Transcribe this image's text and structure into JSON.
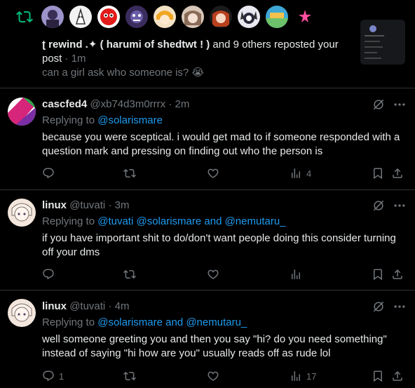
{
  "repost_banner": {
    "avatars": [
      "avatar-1",
      "avatar-2",
      "avatar-3",
      "avatar-4",
      "avatar-5",
      "avatar-6",
      "avatar-7",
      "avatar-8",
      "avatar-9",
      "avatar-10"
    ],
    "display_name": "ʈ rewind .✦ ( harumi of shedtwt ! )",
    "suffix": " and 9 others reposted your",
    "line2_word": "post",
    "sep": " · ",
    "time": "1m",
    "snippet": "can a girl ask who someone is? 😭"
  },
  "tweets": [
    {
      "name": "cascfed4",
      "handle": "@xb74d3m0rrrx",
      "sep": " · ",
      "time": "2m",
      "replying_prefix": "Replying to ",
      "replying_to": "@solarismare",
      "text": "because you were sceptical. i would get mad to if someone responded with a question mark and pressing on finding out who the person is",
      "reply_count": "",
      "repost_count": "",
      "like_count": "",
      "view_count": "4"
    },
    {
      "name": "linux",
      "handle": "@tuvati",
      "sep": " · ",
      "time": "3m",
      "replying_prefix": "Replying to ",
      "replying_to": "@tuvati @solarismare and @nemutaru_",
      "text": "if you have important shit to do/don't want people doing this consider turning off your dms",
      "reply_count": "",
      "repost_count": "",
      "like_count": "",
      "view_count": ""
    },
    {
      "name": "linux",
      "handle": "@tuvati",
      "sep": " · ",
      "time": "4m",
      "replying_prefix": "Replying to ",
      "replying_to": "@solarismare and @nemutaru_",
      "text": "well someone greeting you and then you say \"hi? do you need something\" instead of saying \"hi how are you\" usually reads off as rude lol",
      "reply_count": "1",
      "repost_count": "",
      "like_count": "",
      "view_count": "17"
    }
  ],
  "colors": {
    "background": "#000000",
    "text": "#e7e9ea",
    "muted": "#71767b",
    "link": "#1d9bf0",
    "repost_green": "#00ba7c",
    "divider": "#2f3336"
  }
}
